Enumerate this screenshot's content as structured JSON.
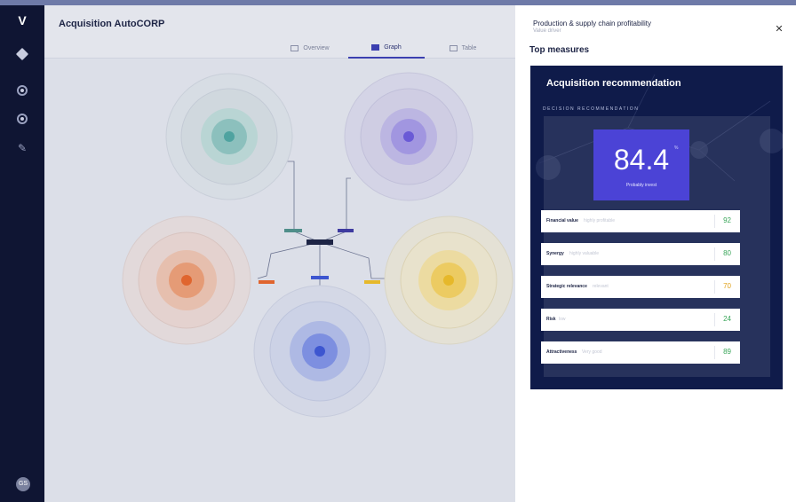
{
  "app": {
    "title": "Acquisition AutoCORP"
  },
  "rail": {
    "logo": "V",
    "avatar_initials": "GS"
  },
  "tabs": [
    {
      "label": "Overview",
      "icon": "grid-icon",
      "active": false
    },
    {
      "label": "Graph",
      "icon": "graph-icon",
      "active": true
    },
    {
      "label": "Table",
      "icon": "table-icon",
      "active": false
    }
  ],
  "graph": {
    "clusters": [
      {
        "name": "teal-cluster",
        "color": "#4fa3a0"
      },
      {
        "name": "purple-cluster",
        "color": "#6a5ad6"
      },
      {
        "name": "orange-cluster",
        "color": "#e0652e"
      },
      {
        "name": "yellow-cluster",
        "color": "#e6b82a"
      },
      {
        "name": "blue-cluster",
        "color": "#3d56d0"
      }
    ],
    "center_color": "#1d2445"
  },
  "panel": {
    "title": "Production & supply chain profitability",
    "subtitle": "Value driver",
    "section_title": "Top measures",
    "close_icon": "close-icon"
  },
  "card": {
    "title": "Acquisition recommendation",
    "caption": "DECISION RECOMMENDATION",
    "score": "84.4",
    "score_sup": "%",
    "score_label": "Probably invest",
    "metrics": [
      {
        "name": "Financial value",
        "desc": "highly profitable",
        "value": "92",
        "color": "#3aa65a"
      },
      {
        "name": "Synergy",
        "desc": "highly valuable",
        "value": "80",
        "color": "#3aa65a"
      },
      {
        "name": "Strategic relevance",
        "desc": "relevant",
        "value": "70",
        "color": "#e0a21b"
      },
      {
        "name": "Risk",
        "desc": "low",
        "value": "24",
        "color": "#3aa65a"
      },
      {
        "name": "Attractiveness",
        "desc": "Very good",
        "value": "89",
        "color": "#3aa65a"
      }
    ]
  }
}
